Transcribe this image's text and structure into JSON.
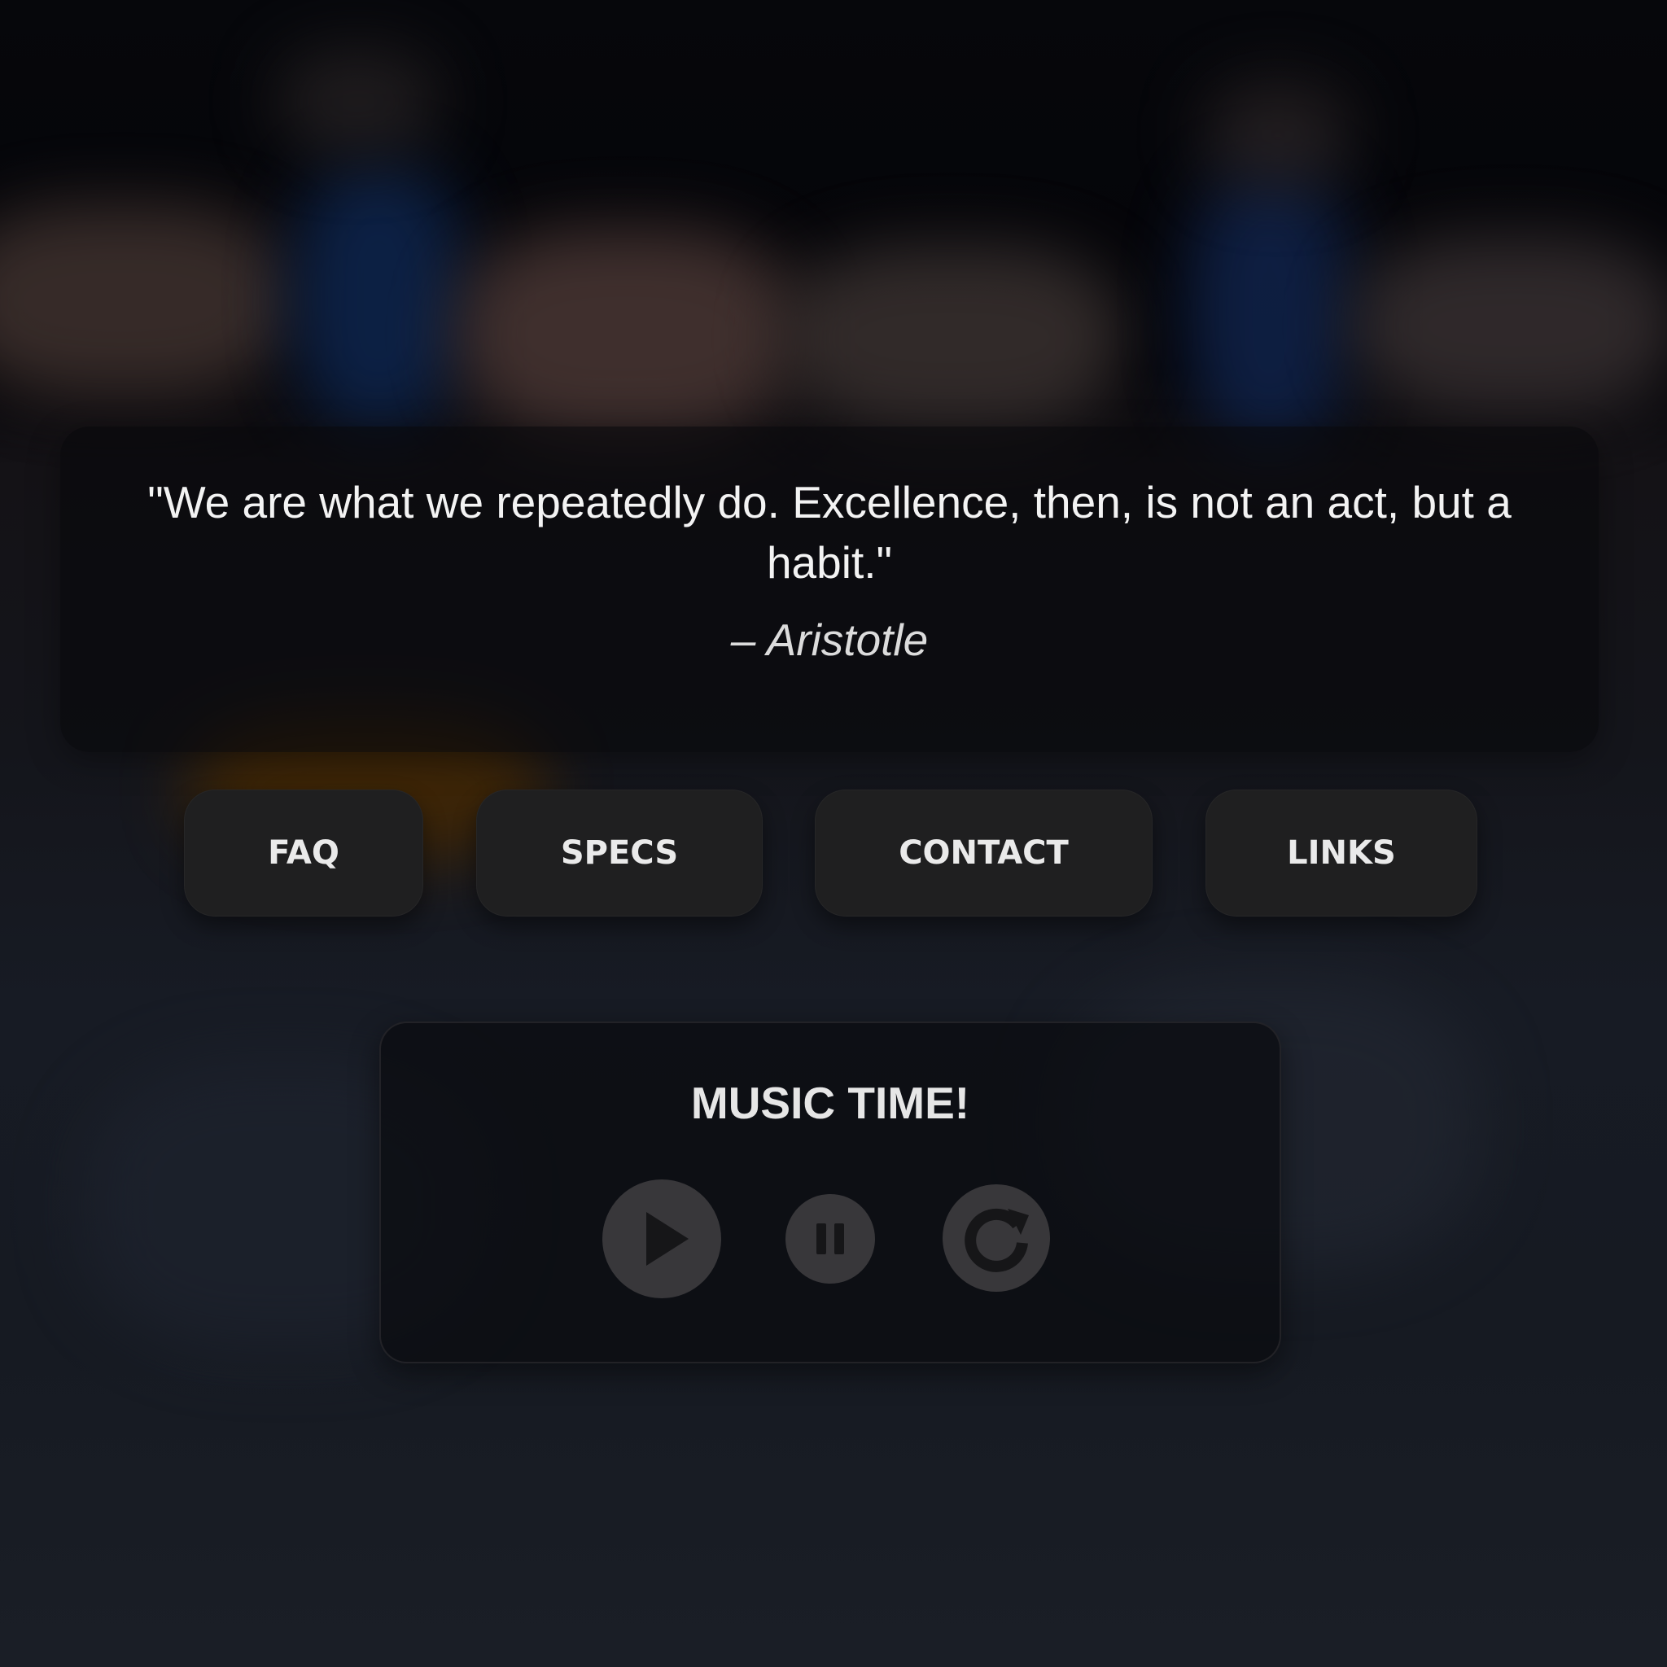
{
  "quote": {
    "text": "\"We are what we repeatedly do. Excellence, then, is not an act, but a habit.\"",
    "author": "– Aristotle"
  },
  "nav": {
    "faq": "FAQ",
    "specs": "SPECS",
    "contact": "CONTACT",
    "links": "LINKS"
  },
  "music": {
    "title": "MUSIC TIME!",
    "controls": {
      "play_icon": "play-icon",
      "pause_icon": "pause-icon",
      "replay_icon": "replay-icon"
    }
  },
  "colors": {
    "button_bg": "#1f1f20",
    "control_bg": "#38373a",
    "text": "#eaeaea"
  }
}
